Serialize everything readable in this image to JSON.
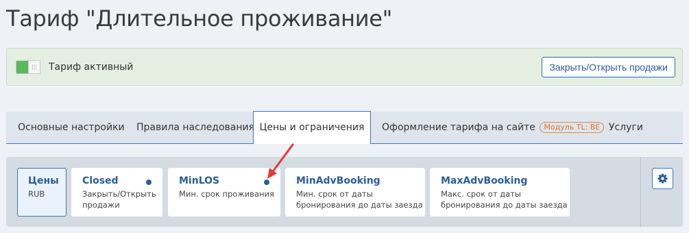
{
  "page_title": "Тариф \"Длительное проживание\"",
  "status_panel": {
    "active_label": "Тариф активный",
    "sales_button": "Закрыть/Открыть продажи"
  },
  "tabs": [
    {
      "label": "Основные настройки"
    },
    {
      "label": "Правила наследования"
    },
    {
      "label": "Цены и ограничения"
    },
    {
      "label": "Оформление тарифа на сайте",
      "badge": "Модуль TL: BE"
    },
    {
      "label": "Услуги"
    }
  ],
  "rate_cards": [
    {
      "title": "Цены",
      "sub": [
        "RUB"
      ]
    },
    {
      "title": "Closed",
      "sub": [
        "Закрыть/Открыть",
        "продажи"
      ]
    },
    {
      "title": "MinLOS",
      "sub": [
        "Мин. срок проживания"
      ]
    },
    {
      "title": "MinAdvBooking",
      "sub": [
        "Мин. срок от даты",
        "бронирования до даты заезда"
      ]
    },
    {
      "title": "MaxAdvBooking",
      "sub": [
        "Макс. срок от даты",
        "бронирования до даты заезда"
      ]
    }
  ],
  "colors": {
    "accent": "#2a5d9a",
    "toggle_on": "#5cb85c",
    "badge": "#e08a3a",
    "arrow": "#e53935"
  },
  "icons": {
    "settings": "gear-icon",
    "annotation": "red-arrow"
  }
}
